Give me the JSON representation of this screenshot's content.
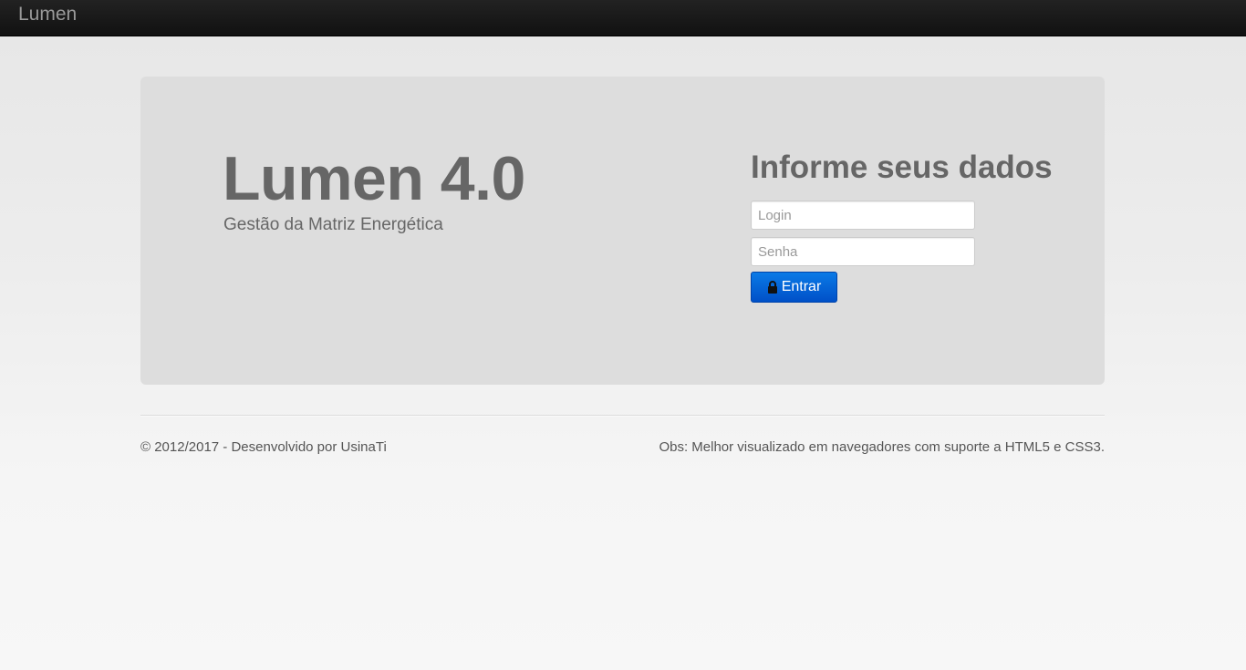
{
  "navbar": {
    "brand": "Lumen"
  },
  "hero": {
    "title": "Lumen 4.0",
    "subtitle": "Gestão da Matriz Energética"
  },
  "login": {
    "title": "Informe seus dados",
    "login_placeholder": "Login",
    "senha_placeholder": "Senha",
    "submit_label": "Entrar",
    "submit_icon": "lock-icon"
  },
  "footer": {
    "copyright": "© 2012/2017 - Desenvolvido por UsinaTi",
    "note": "Obs: Melhor visualizado em navegadores com suporte a HTML5 e CSS3."
  },
  "colors": {
    "navbar_bg": "#1b1b1b",
    "hero_bg": "#dddddd",
    "button_primary": "#0a6ad8",
    "text_muted": "#666666"
  }
}
